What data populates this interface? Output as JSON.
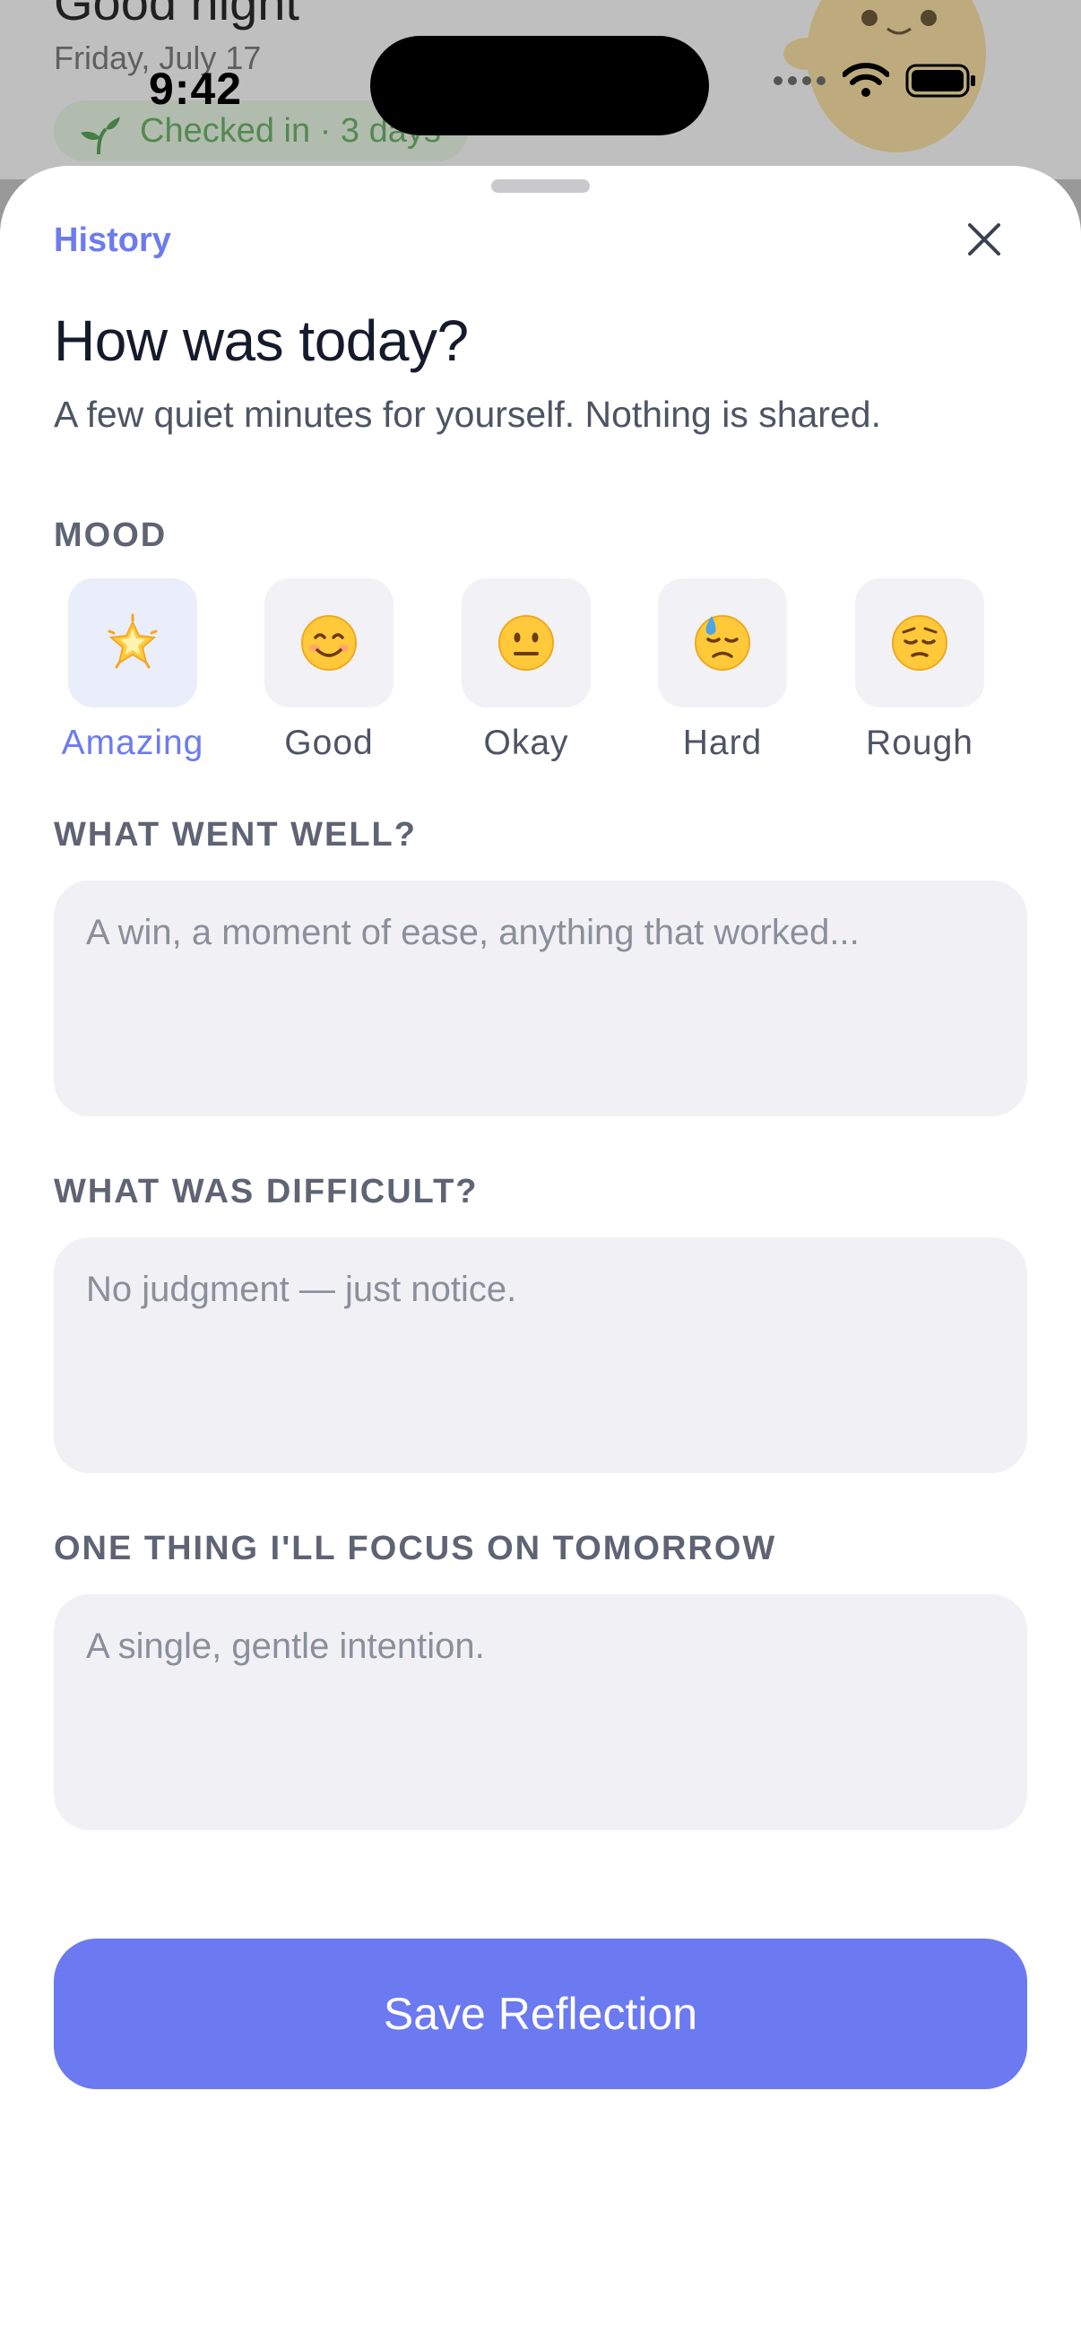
{
  "background": {
    "greeting": "Good night",
    "date": "Friday, July 17",
    "streak_pill": "Checked in · 3 days"
  },
  "status_bar": {
    "time": "9:42"
  },
  "sheet": {
    "history_link": "History",
    "title": "How was today?",
    "subtitle": "A few quiet minutes for yourself. Nothing is shared.",
    "mood": {
      "label": "MOOD",
      "selected": "Amazing",
      "options": [
        {
          "label": "Amazing",
          "icon": "glowing-star-icon",
          "emoji": "🌟"
        },
        {
          "label": "Good",
          "icon": "smiling-face-icon",
          "emoji": "😊"
        },
        {
          "label": "Okay",
          "icon": "neutral-face-icon",
          "emoji": "😐"
        },
        {
          "label": "Hard",
          "icon": "downcast-sweat-face-icon",
          "emoji": "😓"
        },
        {
          "label": "Rough",
          "icon": "pensive-face-icon",
          "emoji": "😔"
        }
      ]
    },
    "went_well": {
      "label": "WHAT WENT WELL?",
      "placeholder": "A win, a moment of ease, anything that worked...",
      "value": ""
    },
    "difficult": {
      "label": "WHAT WAS DIFFICULT?",
      "placeholder": "No judgment — just notice.",
      "value": ""
    },
    "focus": {
      "label": "ONE THING I'LL FOCUS ON TOMORROW",
      "placeholder": "A single, gentle intention.",
      "value": ""
    },
    "save_label": "Save Reflection"
  },
  "colors": {
    "accent": "#6b7af0",
    "accent_text": "#6c7bef",
    "field_bg": "#f1f1f5",
    "label_gray": "#5e6474"
  }
}
